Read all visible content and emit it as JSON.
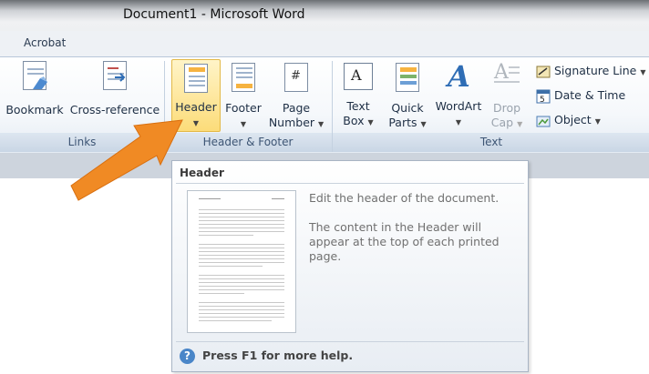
{
  "window": {
    "title": "Document1  -  Microsoft Word"
  },
  "tabs": {
    "active": "Acrobat"
  },
  "ribbon": {
    "groups": {
      "links": {
        "label": "Links",
        "buttons": {
          "bookmark": "Bookmark",
          "cross_reference": "Cross-reference"
        }
      },
      "header_footer": {
        "label": "Header & Footer",
        "buttons": {
          "header": "Header",
          "footer": "Footer",
          "page_number_line1": "Page",
          "page_number_line2": "Number"
        }
      },
      "text": {
        "label": "Text",
        "buttons": {
          "textbox_line1": "Text",
          "textbox_line2": "Box",
          "quickparts_line1": "Quick",
          "quickparts_line2": "Parts",
          "wordart": "WordArt",
          "dropcap_line1": "Drop",
          "dropcap_line2": "Cap",
          "signature_line": "Signature Line",
          "date_time": "Date & Time",
          "object": "Object"
        }
      }
    }
  },
  "tooltip": {
    "title": "Header",
    "description_1": "Edit the header of the document.",
    "description_2": "The content in the Header will appear at the top of each printed page.",
    "help": "Press F1 for more help."
  },
  "colors": {
    "arrow": "#f08a24",
    "highlight": "#fce28a",
    "help_icon": "#4a86c8"
  },
  "icons": [
    "bookmark-icon",
    "cross-reference-icon",
    "header-icon",
    "footer-icon",
    "page-number-icon",
    "textbox-icon",
    "quickparts-icon",
    "wordart-icon",
    "dropcap-icon",
    "signature-line-icon",
    "date-time-icon",
    "object-icon",
    "help-icon"
  ]
}
